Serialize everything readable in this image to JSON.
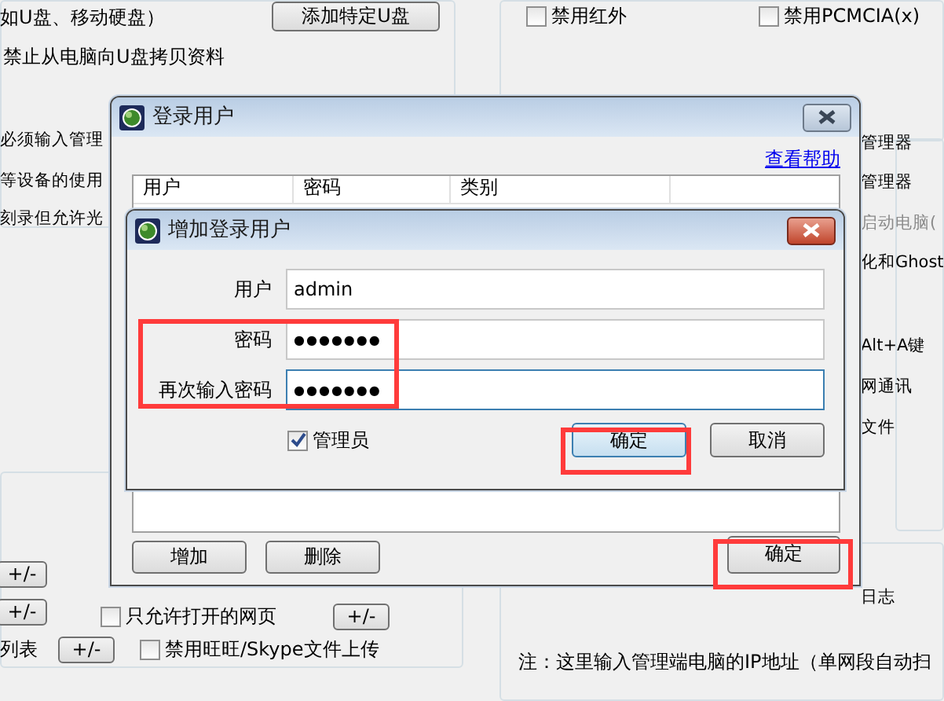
{
  "background": {
    "items": [
      {
        "kind": "text",
        "text": "如U盘、移动硬盘）",
        "disabled": false
      },
      {
        "kind": "button",
        "label": "添加特定U盘"
      },
      {
        "kind": "text",
        "text": "禁止从电脑向U盘拷贝资料",
        "disabled": false
      },
      {
        "kind": "text",
        "text": "必须输入管理",
        "disabled": false
      },
      {
        "kind": "text",
        "text": "等设备的使用",
        "disabled": false
      },
      {
        "kind": "text",
        "text": "刻录但允许光",
        "disabled": false
      },
      {
        "kind": "button",
        "label": "+/-"
      },
      {
        "kind": "button",
        "label": "+/-"
      },
      {
        "kind": "checkbox",
        "label": "只允许打开的网页",
        "checked": false
      },
      {
        "kind": "button",
        "label": "+/-"
      },
      {
        "kind": "text",
        "text": "列表",
        "disabled": false
      },
      {
        "kind": "button",
        "label": "+/-"
      },
      {
        "kind": "checkbox",
        "label": "禁用旺旺/Skype文件上传",
        "checked": false
      },
      {
        "kind": "checkbox",
        "label": "禁用红外",
        "checked": false
      },
      {
        "kind": "checkbox",
        "label": "禁用PCMCIA(x)",
        "checked": false
      },
      {
        "kind": "text",
        "text": "管理器",
        "disabled": false
      },
      {
        "kind": "text",
        "text": "管理器",
        "disabled": false
      },
      {
        "kind": "text",
        "text": "启动电脑(",
        "disabled": true
      },
      {
        "kind": "text",
        "text": "化和Ghost",
        "disabled": false
      },
      {
        "kind": "text",
        "text": "Alt+A键",
        "disabled": false
      },
      {
        "kind": "text",
        "text": "网通讯",
        "disabled": false
      },
      {
        "kind": "text",
        "text": "文件",
        "disabled": false
      },
      {
        "kind": "text",
        "text": "日志",
        "disabled": false
      },
      {
        "kind": "text",
        "text": "注：这里输入管理端电脑的IP地址（单网段自动扫",
        "disabled": false
      }
    ]
  },
  "login_dialog": {
    "title": "登录用户",
    "help_link": "查看帮助",
    "columns": [
      "用户",
      "密码",
      "类别"
    ],
    "buttons": [
      "增加",
      "删除"
    ],
    "ok_button": "确定"
  },
  "add_user_dialog": {
    "title": "增加登录用户",
    "fields": [
      {
        "kind": "text",
        "label": "用户",
        "value": "admin",
        "focused": false
      },
      {
        "kind": "password",
        "label": "密码",
        "value": "●●●●●●●",
        "focused": false
      },
      {
        "kind": "password",
        "label": "再次输入密码",
        "value": "●●●●●●●",
        "focused": true
      }
    ],
    "admin_checkbox": {
      "label": "管理员",
      "checked": true
    },
    "buttons": [
      {
        "label": "确定",
        "default": true
      },
      {
        "label": "取消",
        "default": false
      }
    ]
  }
}
